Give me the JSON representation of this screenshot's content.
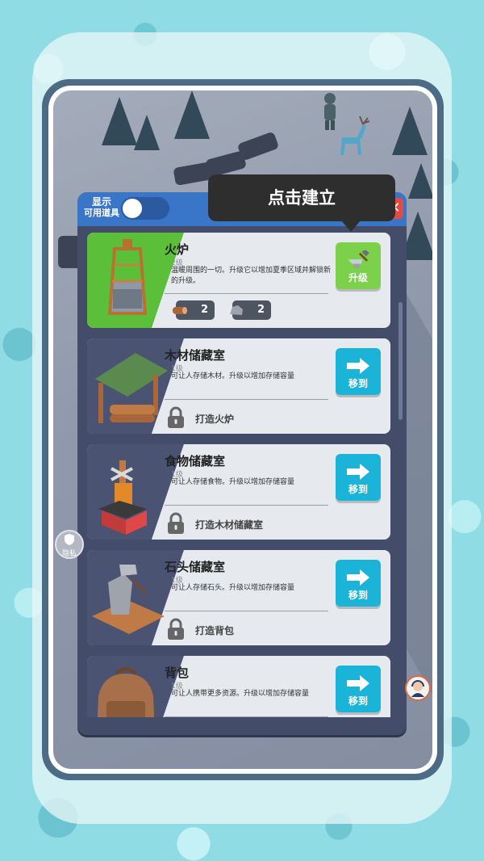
{
  "header": {
    "toggle_line1": "显示",
    "toggle_line2": "可用道具",
    "close_label": "✕"
  },
  "tooltip": {
    "text": "点击建立"
  },
  "items": [
    {
      "title": "火炉",
      "level": "2级",
      "desc": "温暖周围的一切。升级它以增加夏季区域并解锁新的升级。",
      "action": "升级",
      "resources": [
        {
          "icon": "wood-log-icon",
          "count": "2"
        },
        {
          "icon": "stone-icon",
          "count": "2"
        }
      ]
    },
    {
      "title": "木材储藏室",
      "level": "1级",
      "desc": "可让人存储木材。升级以增加存储容量",
      "action": "移到",
      "requirement": "打造火炉"
    },
    {
      "title": "食物储藏室",
      "level": "1级",
      "desc": "可让人存储食物。升级以增加存储容量",
      "action": "移到",
      "requirement": "打造木材储藏室"
    },
    {
      "title": "石头储藏室",
      "level": "1级",
      "desc": "可让人存储石头。升级以增加存储容量",
      "action": "移到",
      "requirement": "打造背包"
    },
    {
      "title": "背包",
      "level": "1级",
      "desc": "可让人携带更多资源。升级以增加存储容量",
      "action": "移到"
    }
  ],
  "side": {
    "privacy_label": "隐私"
  },
  "colors": {
    "header_blue": "#3a76c8",
    "go_button": "#19b4d8",
    "upgrade_button": "#7bd14a",
    "furnace_bg": "#5bbf3a"
  }
}
